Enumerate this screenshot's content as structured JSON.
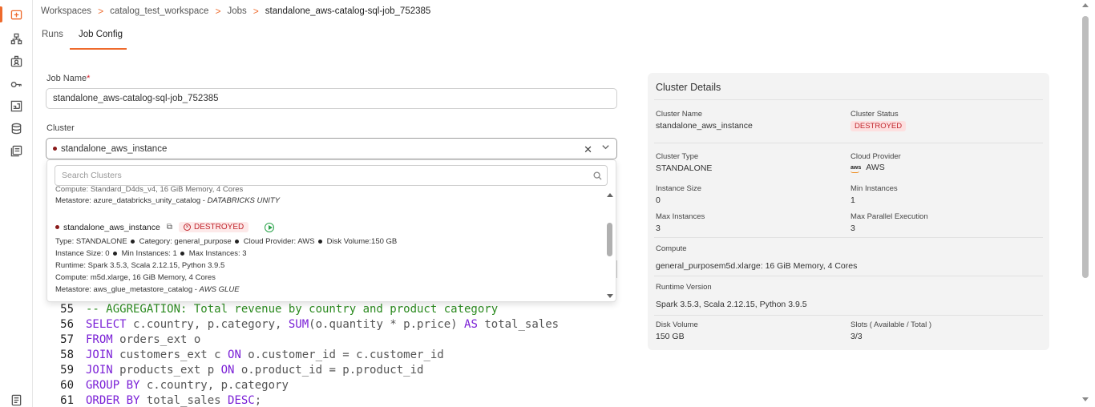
{
  "breadcrumb": {
    "items": [
      "Workspaces",
      "catalog_test_workspace",
      "Jobs",
      "standalone_aws-catalog-sql-job_752385"
    ],
    "separator": ">"
  },
  "tabs": [
    {
      "label": "Runs",
      "active": false
    },
    {
      "label": "Job Config",
      "active": true
    }
  ],
  "form": {
    "job_name_label": "Job Name",
    "required_mark": "*",
    "job_name_value": "standalone_aws-catalog-sql-job_752385",
    "cluster_label": "Cluster",
    "cluster_value": "standalone_aws_instance",
    "clear_glyph": "✕"
  },
  "dropdown": {
    "search_placeholder": "Search Clusters",
    "prev_item": {
      "compute_partial": "Compute: Standard_D4ds_v4, 16 GiB Memory, 4 Cores",
      "metastore_prefix": "Metastore: azure_databricks_unity_catalog - ",
      "metastore_type": "DATABRICKS UNITY"
    },
    "item": {
      "name": "standalone_aws_instance",
      "status": "DESTROYED",
      "type": "Type: STANDALONE",
      "category": "Category: general_purpose",
      "cloud": "Cloud Provider: AWS",
      "disk": "Disk Volume:150 GB",
      "instance_size": "Instance Size: 0",
      "min_instances": "Min Instances: 1",
      "max_instances": "Max Instances: 3",
      "runtime": "Runtime: Spark 3.5.3, Scala 2.12.15, Python 3.9.5",
      "compute": "Compute: m5d.xlarge, 16 GiB Memory, 4 Cores",
      "metastore_prefix": "Metastore: aws_glue_metastore_catalog - ",
      "metastore_type": "AWS GLUE"
    }
  },
  "code": {
    "lines": [
      {
        "n": "55",
        "parts": [
          {
            "t": "-- AGGREGATION: Total revenue by country and product category",
            "c": "c"
          }
        ]
      },
      {
        "n": "56",
        "parts": [
          {
            "t": "SELECT",
            "c": "k"
          },
          {
            "t": " c.country, p.category, ",
            "c": "t"
          },
          {
            "t": "SUM",
            "c": "f"
          },
          {
            "t": "(o.quantity * p.price) ",
            "c": "t"
          },
          {
            "t": "AS",
            "c": "k"
          },
          {
            "t": " total_sales",
            "c": "t"
          }
        ]
      },
      {
        "n": "57",
        "parts": [
          {
            "t": "FROM",
            "c": "k"
          },
          {
            "t": " orders_ext o",
            "c": "t"
          }
        ]
      },
      {
        "n": "58",
        "parts": [
          {
            "t": "JOIN",
            "c": "k"
          },
          {
            "t": " customers_ext c ",
            "c": "t"
          },
          {
            "t": "ON",
            "c": "k"
          },
          {
            "t": " o.customer_id = c.customer_id",
            "c": "t"
          }
        ]
      },
      {
        "n": "59",
        "parts": [
          {
            "t": "JOIN",
            "c": "k"
          },
          {
            "t": " products_ext p ",
            "c": "t"
          },
          {
            "t": "ON",
            "c": "k"
          },
          {
            "t": " o.product_id = p.product_id",
            "c": "t"
          }
        ]
      },
      {
        "n": "60",
        "parts": [
          {
            "t": "GROUP BY",
            "c": "k"
          },
          {
            "t": " c.country, p.category",
            "c": "t"
          }
        ]
      },
      {
        "n": "61",
        "parts": [
          {
            "t": "ORDER BY",
            "c": "k"
          },
          {
            "t": " total_sales ",
            "c": "t"
          },
          {
            "t": "DESC",
            "c": "k"
          },
          {
            "t": ";",
            "c": "t"
          }
        ]
      }
    ]
  },
  "cluster_details": {
    "title": "Cluster Details",
    "cluster_name_label": "Cluster Name",
    "cluster_name": "standalone_aws_instance",
    "cluster_status_label": "Cluster Status",
    "cluster_status": "DESTROYED",
    "cluster_type_label": "Cluster Type",
    "cluster_type": "STANDALONE",
    "cloud_provider_label": "Cloud Provider",
    "cloud_provider": "AWS",
    "aws_logo_text": "aws",
    "instance_size_label": "Instance Size",
    "instance_size": "0",
    "min_instances_label": "Min Instances",
    "min_instances": "1",
    "max_instances_label": "Max Instances",
    "max_instances": "3",
    "max_parallel_label": "Max Parallel Execution",
    "max_parallel": "3",
    "compute_label": "Compute",
    "compute": "general_purposem5d.xlarge:  16 GiB Memory,  4 Cores",
    "runtime_label": "Runtime Version",
    "runtime": "Spark 3.5.3, Scala 2.12.15, Python 3.9.5",
    "disk_label": "Disk Volume",
    "disk": "150 GB",
    "slots_label": "Slots ( Available / Total )",
    "slots": "3/3"
  },
  "colors": {
    "accent": "#ee6a2c",
    "destroyed": "#c0262d",
    "keyword": "#7a1fd6",
    "comment": "#2b8a1f"
  },
  "rail_icons": [
    "jobs-icon",
    "hierarchy-icon",
    "users-icon",
    "key-icon",
    "dashboard-icon",
    "database-icon",
    "catalog-icon",
    "docs-icon"
  ]
}
